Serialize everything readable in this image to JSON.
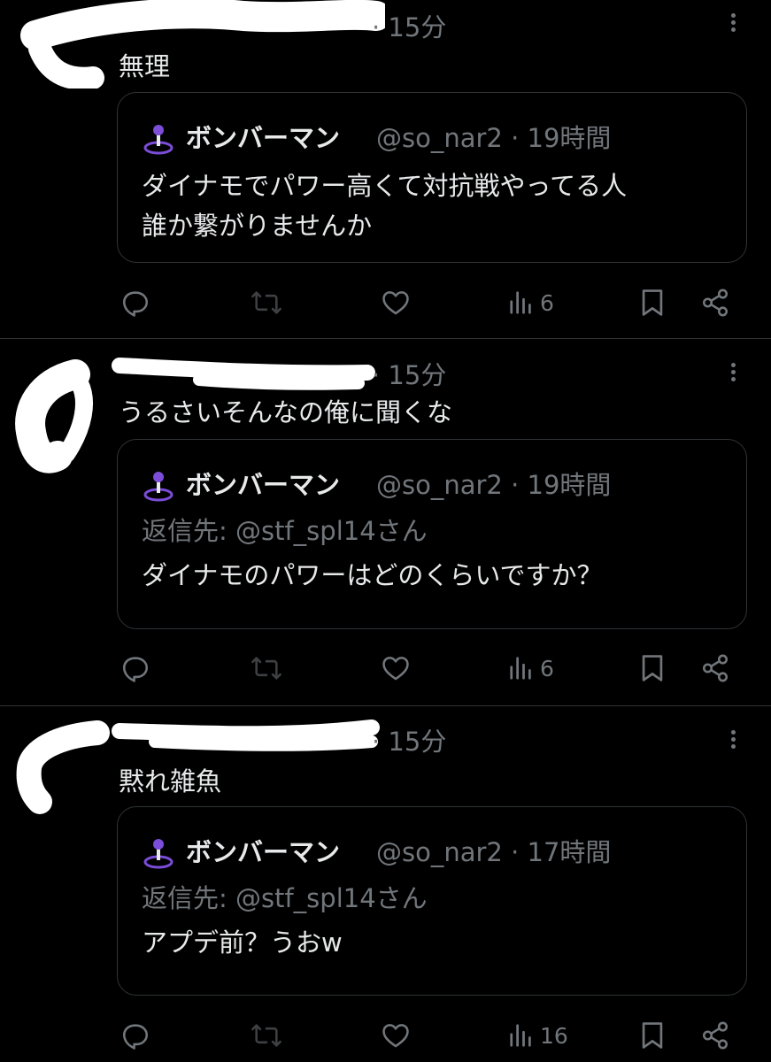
{
  "posts": [
    {
      "time": "· 15分",
      "text": "無理",
      "quote": {
        "name": "ボンバーマン",
        "meta": "@so_nar2 · 19時間",
        "reply_to": "",
        "lines": [
          "ダイナモでパワー高くて対抗戦やってる人",
          "誰か繋がりませんか"
        ]
      },
      "views": "6"
    },
    {
      "time": "· 15分",
      "text": "うるさいそんなの俺に聞くな",
      "quote": {
        "name": "ボンバーマン",
        "meta": "@so_nar2 · 19時間",
        "reply_to": "返信先: @stf_spl14さん",
        "lines": [
          "ダイナモのパワーはどのくらいですか？"
        ]
      },
      "views": "6"
    },
    {
      "time": "· 15分",
      "text": "黙れ雑魚",
      "quote": {
        "name": "ボンバーマン",
        "meta": "@so_nar2 · 17時間",
        "reply_to": "返信先: @stf_spl14さん",
        "lines": [
          "アプデ前？うおw"
        ]
      },
      "views": "16"
    }
  ],
  "colors": {
    "background": "#000000",
    "text": "#e7e9ea",
    "muted": "#71767b",
    "border": "#2f3336",
    "avatar_accent": "#7b4dd8"
  },
  "icons": [
    "reply-icon",
    "retweet-icon",
    "like-icon",
    "views-icon",
    "bookmark-icon",
    "share-icon",
    "more-icon"
  ]
}
